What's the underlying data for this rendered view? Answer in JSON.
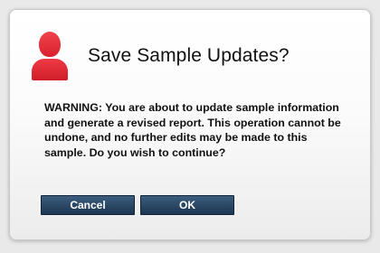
{
  "dialog": {
    "title": "Save Sample Updates?",
    "icon": "user-icon",
    "message": "WARNING: You are about to update sample information and generate a revised report. This operation cannot be undone, and no further edits may be made to this sample. Do you wish to continue?",
    "buttons": {
      "cancel_label": "Cancel",
      "ok_label": "OK"
    }
  },
  "colors": {
    "icon": "#e0303a",
    "button_bg": "#2b4866",
    "button_text": "#ffffff",
    "dialog_bg": "#ffffff"
  }
}
